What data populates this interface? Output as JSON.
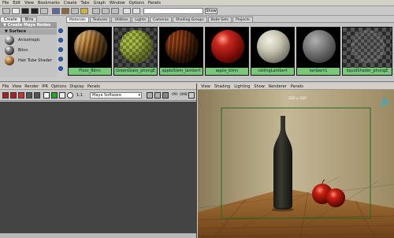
{
  "hypershade": {
    "menu": [
      "File",
      "Edit",
      "View",
      "Bookmarks",
      "Create",
      "Tabs",
      "Graph",
      "Window",
      "Options",
      "Panels"
    ],
    "search_button": "Show",
    "left_tabs": [
      "Create",
      "Bins"
    ],
    "create_header": "Create Maya Nodes",
    "surface_header": "Surface",
    "node_types": [
      {
        "label": "Anisotropic"
      },
      {
        "label": "Blinn"
      },
      {
        "label": "Hair Tube Shader"
      }
    ],
    "shading_tabs": [
      "Materials",
      "Textures",
      "Utilities",
      "Lights",
      "Cameras",
      "Shading Groups",
      "Bake Sets",
      "Projects"
    ],
    "swatches": [
      {
        "label": "Floor_Blinn"
      },
      {
        "label": "GreenGlass_phongE"
      },
      {
        "label": "appleStem_lambert"
      },
      {
        "label": "apple_blinn"
      },
      {
        "label": "ceilingLambert"
      },
      {
        "label": "lambert1"
      },
      {
        "label": "liquidShader_phongE"
      }
    ]
  },
  "render_view": {
    "menu": [
      "File",
      "View",
      "Render",
      "IPR",
      "Options",
      "Display",
      "Panels"
    ],
    "ratio": "1:1",
    "renderer": "Maya Software",
    "ipr_label": "IPR: 0MB"
  },
  "viewport": {
    "menu": [
      "View",
      "Shading",
      "Lighting",
      "Show",
      "Renderer",
      "Panels"
    ],
    "resolution": "320 x 240"
  },
  "colors": {
    "swatch_label_bg": "#78c878",
    "menu_bg": "#d4d0c8",
    "panel_bg": "#c3c3c3",
    "render_canvas": "#444444",
    "resolution_gate": "#1f6b1f"
  }
}
